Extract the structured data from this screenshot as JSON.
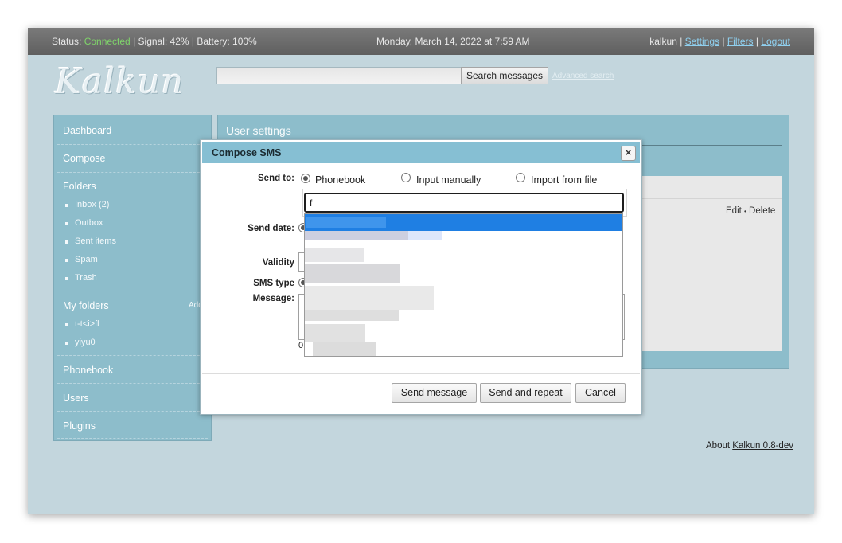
{
  "topbar": {
    "status_label": "Status: ",
    "status_value": "Connected",
    "signal": " | Signal: 42% | Battery: 100%",
    "datetime": "Monday, March 14, 2022 at 7:59 AM",
    "username": "kalkun",
    "sep": " | ",
    "settings": "Settings",
    "filters": "Filters",
    "logout": "Logout",
    "status_color": "#7fd36a"
  },
  "logo": {
    "text": "Kalkun"
  },
  "search": {
    "button_label": "Search messages",
    "advanced_label": "Advanced search",
    "value": ""
  },
  "sidebar": {
    "dashboard": "Dashboard",
    "compose": "Compose",
    "folders": "Folders",
    "folder_items": [
      "Inbox (2)",
      "Outbox",
      "Sent items",
      "Spam",
      "Trash"
    ],
    "my_folders": "My folders",
    "add": "Add",
    "my_folder_items": [
      "t-t<i>ff",
      "yiyu0"
    ],
    "phonebook": "Phonebook",
    "users": "Users",
    "plugins": "Plugins"
  },
  "main": {
    "title": "User settings",
    "edit": "Edit",
    "dot": "•",
    "delete": "Delete"
  },
  "footer": {
    "about_prefix": "About ",
    "about_link": "Kalkun 0.8-dev"
  },
  "modal": {
    "title": "Compose SMS",
    "close_icon": "×",
    "send_to_label": "Send to:",
    "send_to_options": [
      "Phonebook",
      "Input manually",
      "Import from file"
    ],
    "send_to_selected": "Phonebook",
    "phonebook_input_value": "f",
    "send_date_label": "Send date:",
    "validity_label": "Validity",
    "sms_type_label": "SMS type",
    "message_label": "Message:",
    "partial_counter": "0",
    "buttons": {
      "send": "Send message",
      "send_repeat": "Send and repeat",
      "cancel": "Cancel"
    },
    "accent_color": "#86bfd3",
    "highlight_color": "#1f7fe3"
  }
}
